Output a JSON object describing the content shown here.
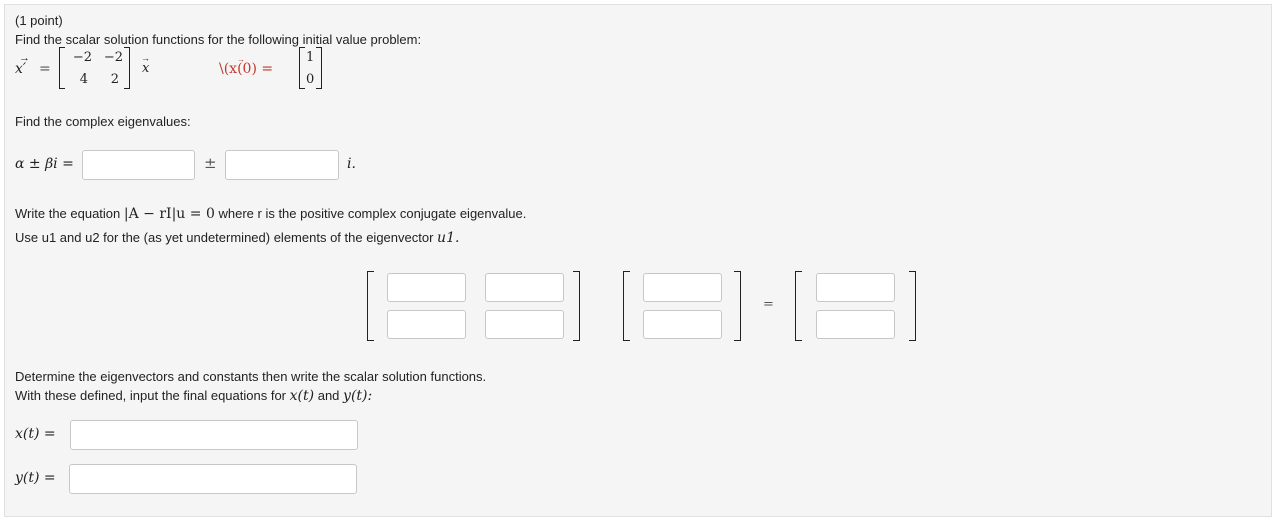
{
  "header": {
    "points": "(1 point)"
  },
  "problem": {
    "instruction": "Find the scalar solution functions for the following initial value problem:",
    "lhs": "x′",
    "equals": "=",
    "matrix": [
      "−2",
      "−2",
      "4",
      "2"
    ],
    "vec": "x",
    "ic_text": "\\(x(0) =",
    "ic_vector": [
      "1",
      "0"
    ]
  },
  "eigen": {
    "prompt": "Find the complex eigenvalues:",
    "label": "α ± βi =",
    "pm": "±",
    "suffix": "i.",
    "alpha_value": "",
    "beta_value": ""
  },
  "eigvec": {
    "line1_pre": "Write the equation",
    "line1_math": "|A − rI|u = 0",
    "line1_post": "where r is the positive complex conjugate eigenvalue.",
    "line2_pre": "Use u1 and u2 for the (as yet undetermined) elements of the eigenvector",
    "line2_math": "u1.",
    "equals": "="
  },
  "solution": {
    "line1": "Determine the eigenvectors and constants then write the scalar solution functions.",
    "line2_pre": "With these defined, input the final equations for",
    "x_sym": "x(t)",
    "and": "and",
    "y_sym": "y(t):",
    "x_label": "x(t) =",
    "y_label": "y(t) =",
    "x_value": "",
    "y_value": ""
  }
}
